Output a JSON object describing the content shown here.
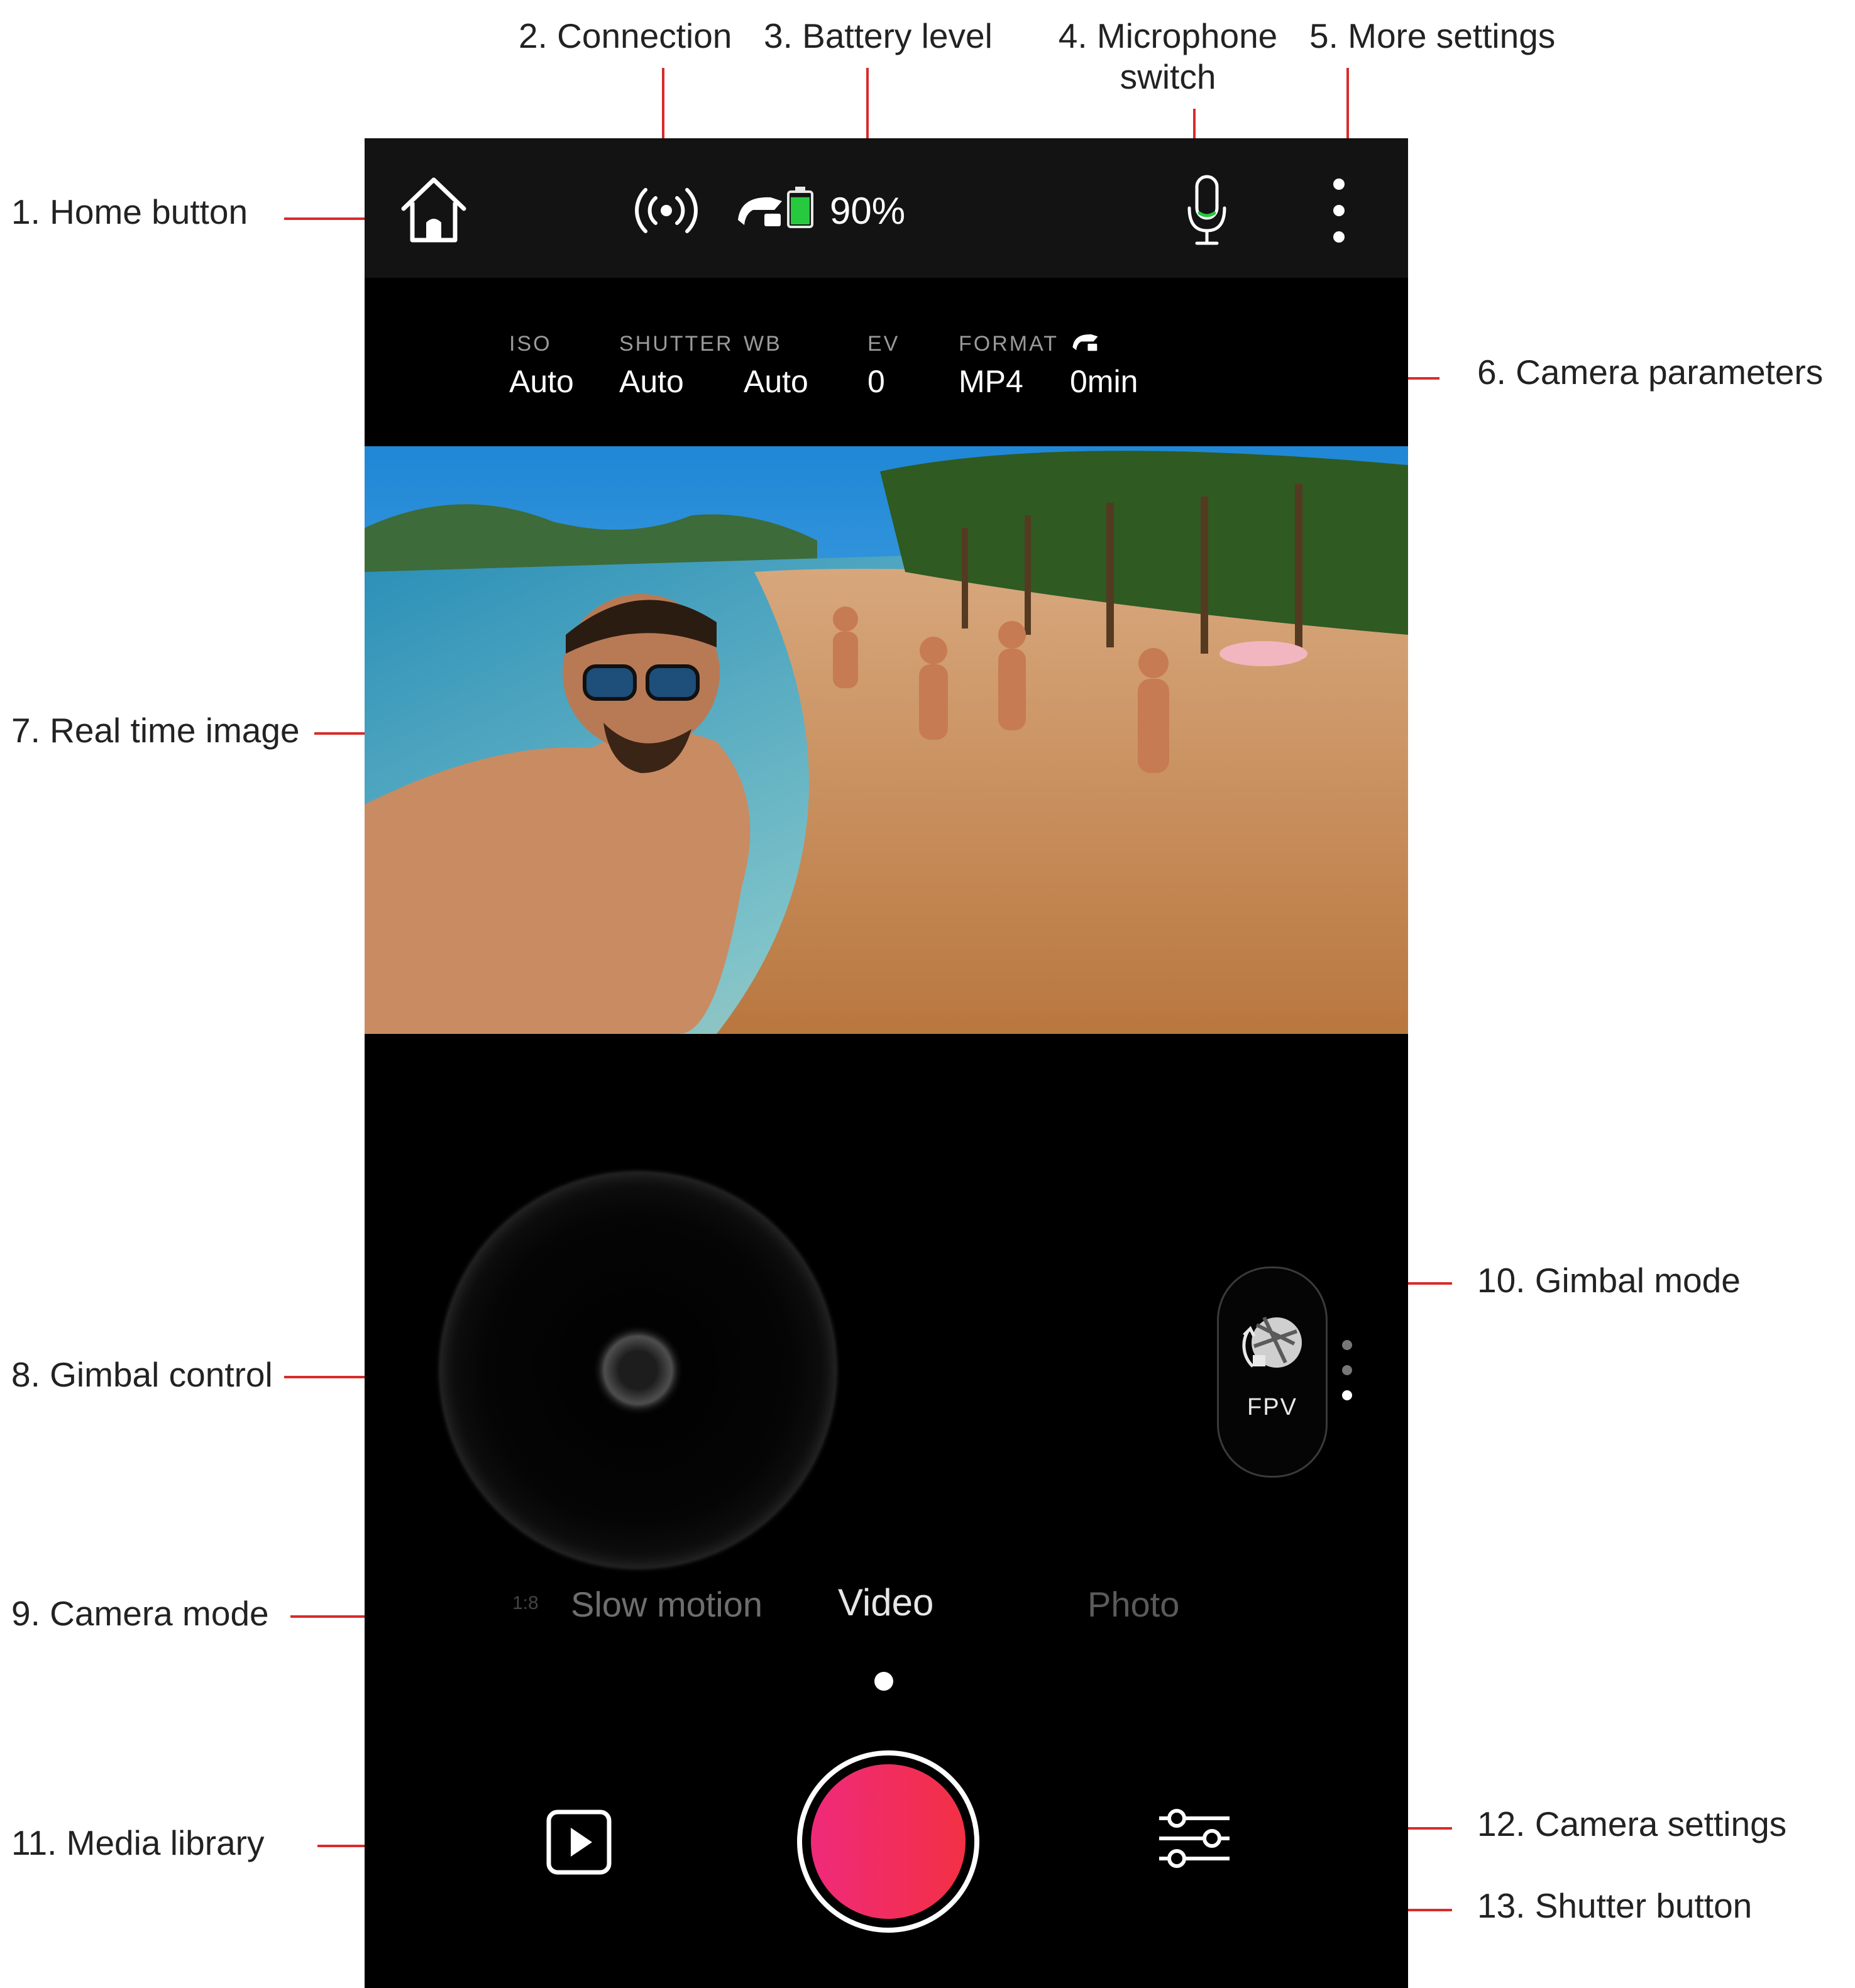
{
  "annotations": {
    "home": "1. Home button",
    "connection": "2. Connection",
    "battery": "3. Battery level",
    "microphone_line1": "4. Microphone",
    "microphone_line2": "switch",
    "more": "5. More settings",
    "params": "6. Camera parameters",
    "realtime": "7.  Real time image",
    "gimbal_control": "8. Gimbal control",
    "camera_mode": "9. Camera mode",
    "gimbal_mode": "10. Gimbal mode",
    "media": "11. Media library",
    "camera_settings": "12. Camera settings",
    "shutter": "13. Shutter button"
  },
  "topbar": {
    "battery_percent": "90%",
    "battery_level": 0.9,
    "icons": [
      "home-icon",
      "signal-icon",
      "gimbal-device-icon",
      "battery-icon",
      "microphone-icon",
      "more-vertical-icon"
    ]
  },
  "camera_params": [
    {
      "label": "ISO",
      "value": "Auto"
    },
    {
      "label": "SHUTTER",
      "value": "Auto"
    },
    {
      "label": "WB",
      "value": "Auto"
    },
    {
      "label": "EV",
      "value": "0"
    },
    {
      "label": "FORMAT",
      "value": "MP4"
    },
    {
      "label": "",
      "value": "0min",
      "icon": "gimbal-device-icon"
    }
  ],
  "gimbal_mode": {
    "label": "FPV",
    "active_index": 2,
    "count": 3
  },
  "modes": {
    "slow_motion": "Slow motion",
    "video": "Video",
    "photo": "Photo",
    "active": "Video"
  },
  "colors": {
    "annotation_line": "#d92b2b",
    "battery_fill": "#27c93f",
    "shutter_start": "#ef2a7a",
    "shutter_end": "#f33044"
  }
}
